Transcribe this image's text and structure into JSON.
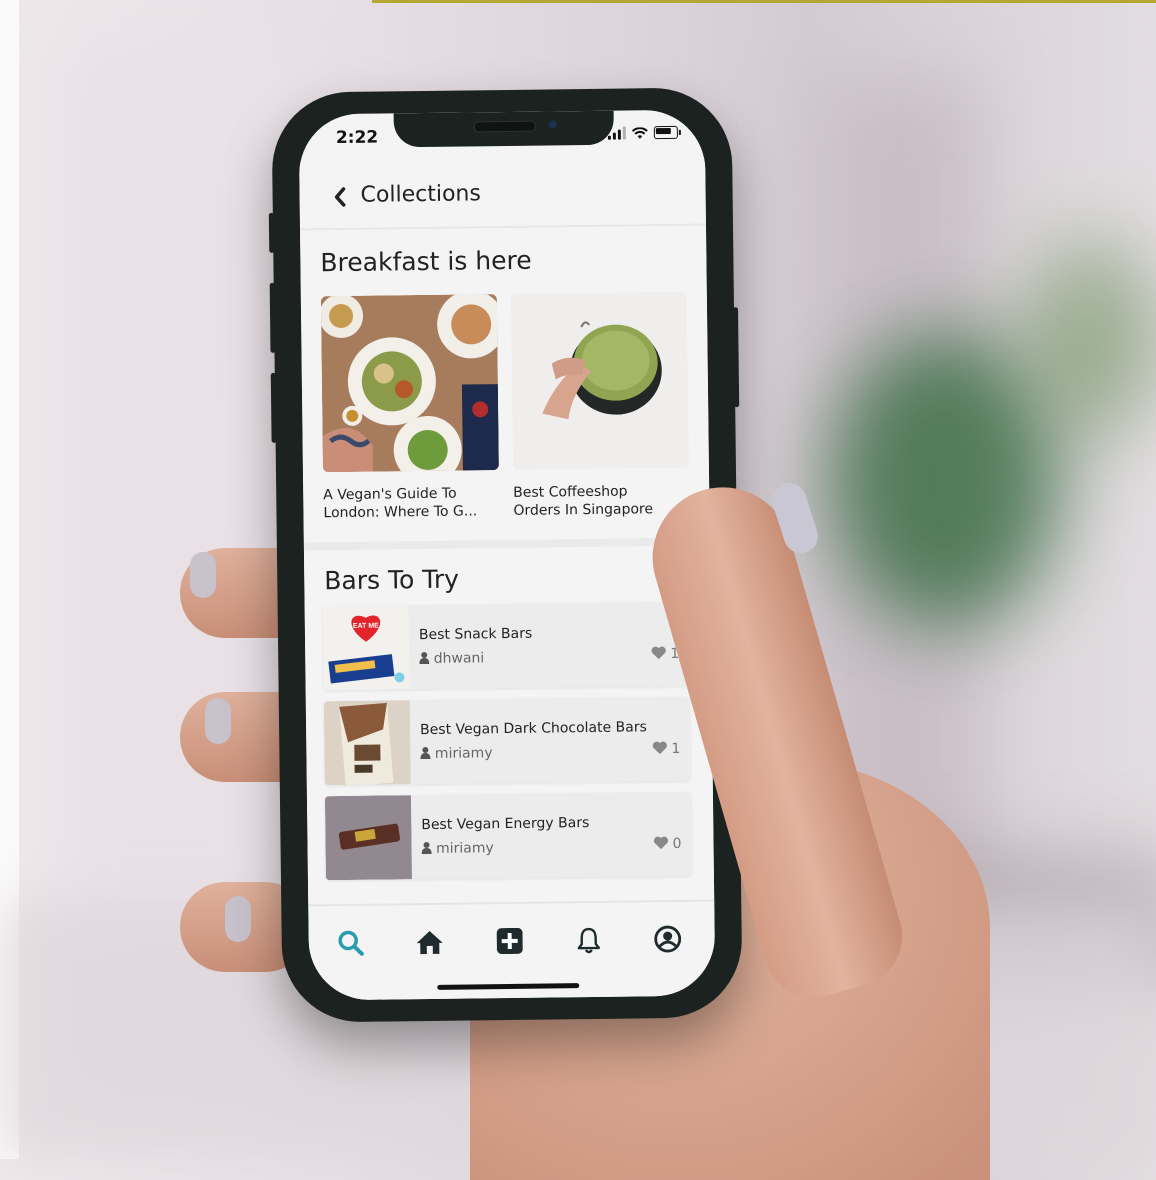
{
  "status_bar": {
    "time": "2:22"
  },
  "header": {
    "title": "Collections",
    "back_icon": "chevron-left-icon"
  },
  "breakfast": {
    "title": "Breakfast is here",
    "cards": [
      {
        "caption": "A Vegan's Guide To\nLondon: Where To G..."
      },
      {
        "caption": "Best Coffeeshop\nOrders In Singapore"
      }
    ]
  },
  "bars": {
    "title": "Bars To Try",
    "items": [
      {
        "title": "Best Snack Bars",
        "user": "dhwani",
        "likes": "1"
      },
      {
        "title": "Best Vegan Dark Chocolate Bars",
        "user": "miriamy",
        "likes": "1"
      },
      {
        "title": "Best Vegan Energy Bars",
        "user": "miriamy",
        "likes": "0"
      }
    ]
  },
  "tabbar": {
    "tabs": [
      "search-icon",
      "home-icon",
      "add-icon",
      "bell-icon",
      "profile-icon"
    ],
    "active_color": "#2a9bb0",
    "icon_color": "#1f2a2c"
  },
  "colors": {
    "screen_bg": "#f4f4f4",
    "text": "#222222",
    "accent": "#2a9bb0"
  }
}
